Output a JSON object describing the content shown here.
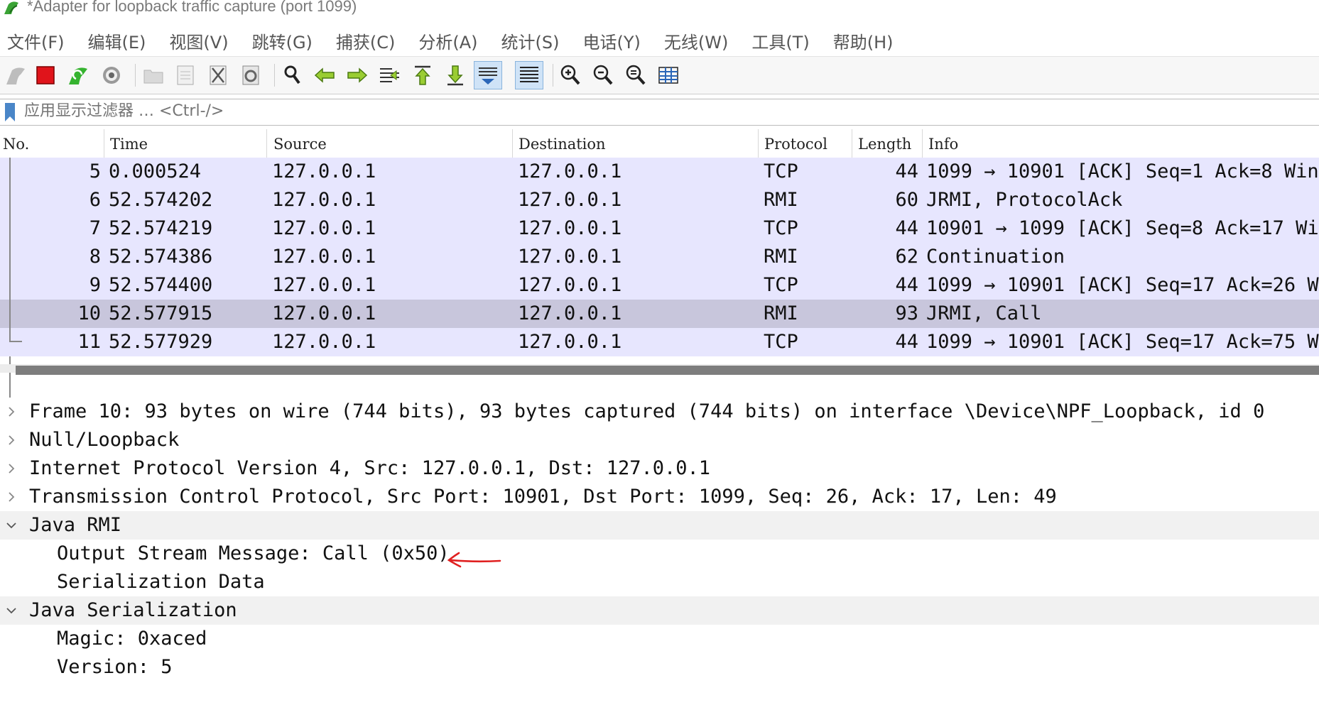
{
  "window": {
    "title": "*Adapter for loopback traffic capture (port 1099)",
    "app_icon": "wireshark-fin-icon"
  },
  "menu": [
    "文件(F)",
    "编辑(E)",
    "视图(V)",
    "跳转(G)",
    "捕获(C)",
    "分析(A)",
    "统计(S)",
    "电话(Y)",
    "无线(W)",
    "工具(T)",
    "帮助(H)"
  ],
  "toolbar": {
    "icons": [
      "shark-fin-start-icon",
      "stop-capture-icon",
      "restart-capture-icon",
      "capture-options-icon",
      "open-file-icon",
      "save-file-icon",
      "close-file-icon",
      "reload-file-icon",
      "find-packet-icon",
      "go-back-icon",
      "go-forward-icon",
      "go-to-packet-icon",
      "first-packet-icon",
      "last-packet-icon",
      "autoscroll-icon",
      "colorize-icon",
      "zoom-in-icon",
      "zoom-out-icon",
      "normal-size-icon",
      "resize-columns-icon"
    ]
  },
  "filter": {
    "placeholder": "应用显示过滤器 … <Ctrl-/>",
    "bookmark_icon": "bookmark-icon"
  },
  "packet_list": {
    "columns": [
      "No.",
      "Time",
      "Source",
      "Destination",
      "Protocol",
      "Length",
      "Info"
    ],
    "rows": [
      {
        "no": "5",
        "time": "0.000524",
        "src": "127.0.0.1",
        "dst": "127.0.0.1",
        "proto": "TCP",
        "len": "44",
        "info": "1099 → 10901 [ACK] Seq=1 Ack=8 Win"
      },
      {
        "no": "6",
        "time": "52.574202",
        "src": "127.0.0.1",
        "dst": "127.0.0.1",
        "proto": "RMI",
        "len": "60",
        "info": "JRMI, ProtocolAck"
      },
      {
        "no": "7",
        "time": "52.574219",
        "src": "127.0.0.1",
        "dst": "127.0.0.1",
        "proto": "TCP",
        "len": "44",
        "info": "10901 → 1099 [ACK] Seq=8 Ack=17 Wi"
      },
      {
        "no": "8",
        "time": "52.574386",
        "src": "127.0.0.1",
        "dst": "127.0.0.1",
        "proto": "RMI",
        "len": "62",
        "info": "Continuation"
      },
      {
        "no": "9",
        "time": "52.574400",
        "src": "127.0.0.1",
        "dst": "127.0.0.1",
        "proto": "TCP",
        "len": "44",
        "info": "1099 → 10901 [ACK] Seq=17 Ack=26 W"
      },
      {
        "no": "10",
        "time": "52.577915",
        "src": "127.0.0.1",
        "dst": "127.0.0.1",
        "proto": "RMI",
        "len": "93",
        "info": "JRMI, Call"
      },
      {
        "no": "11",
        "time": "52.577929",
        "src": "127.0.0.1",
        "dst": "127.0.0.1",
        "proto": "TCP",
        "len": "44",
        "info": "1099 → 10901 [ACK] Seq=17 Ack=75 W"
      }
    ],
    "selected_no": "10",
    "row_color": "#e7e6fe",
    "selected_color": "#c8c6dc"
  },
  "details": [
    {
      "text": "Frame 10: 93 bytes on wire (744 bits), 93 bytes captured (744 bits) on interface \\Device\\NPF_Loopback, id 0",
      "expander": "collapsed"
    },
    {
      "text": "Null/Loopback",
      "expander": "collapsed"
    },
    {
      "text": "Internet Protocol Version 4, Src: 127.0.0.1, Dst: 127.0.0.1",
      "expander": "collapsed"
    },
    {
      "text": "Transmission Control Protocol, Src Port: 10901, Dst Port: 1099, Seq: 26, Ack: 17, Len: 49",
      "expander": "collapsed"
    },
    {
      "text": "Java RMI",
      "expander": "expanded"
    },
    {
      "text": "Output Stream Message: Call (0x50)",
      "expander": "none"
    },
    {
      "text": "Serialization Data",
      "expander": "none"
    },
    {
      "text": "Java Serialization",
      "expander": "expanded"
    },
    {
      "text": "Magic: 0xaced",
      "expander": "none"
    },
    {
      "text": "Version: 5",
      "expander": "none"
    }
  ],
  "annotation": {
    "icon": "red-hand-drawn-arrow-icon",
    "color": "#e02020"
  }
}
